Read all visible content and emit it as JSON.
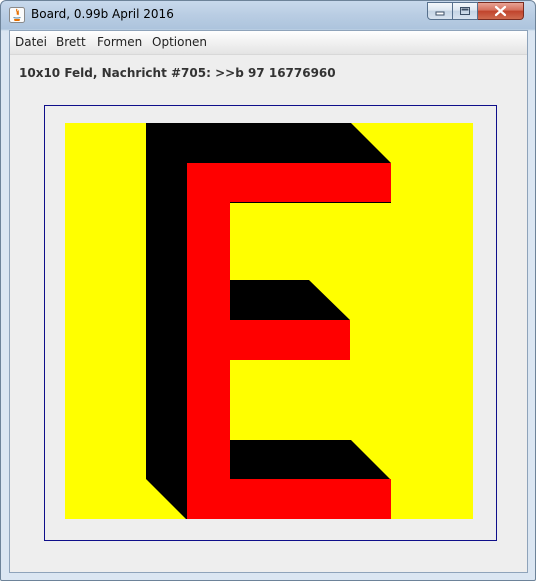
{
  "window": {
    "title": "Board, 0.99b April 2016",
    "app_icon": "java-cup-icon",
    "controls": [
      "minimize-icon",
      "maximize-icon",
      "close-icon"
    ]
  },
  "menubar": {
    "items": [
      {
        "label": "Datei"
      },
      {
        "label": "Brett"
      },
      {
        "label": "Formen"
      },
      {
        "label": "Optionen"
      }
    ]
  },
  "status": {
    "message": "10x10 Feld, Nachricht #705: >>b 97 16776960"
  },
  "board": {
    "rows": 10,
    "cols": 10,
    "background_color": "#ffff00",
    "shadow_color": "#000000",
    "letter_color": "#ff0000",
    "frame_color": "#0e0e8a",
    "symbol": "letter-E-with-3d-shadow"
  },
  "colors": {
    "client_background": "#eeeeee",
    "close_button": "#c0432c"
  }
}
